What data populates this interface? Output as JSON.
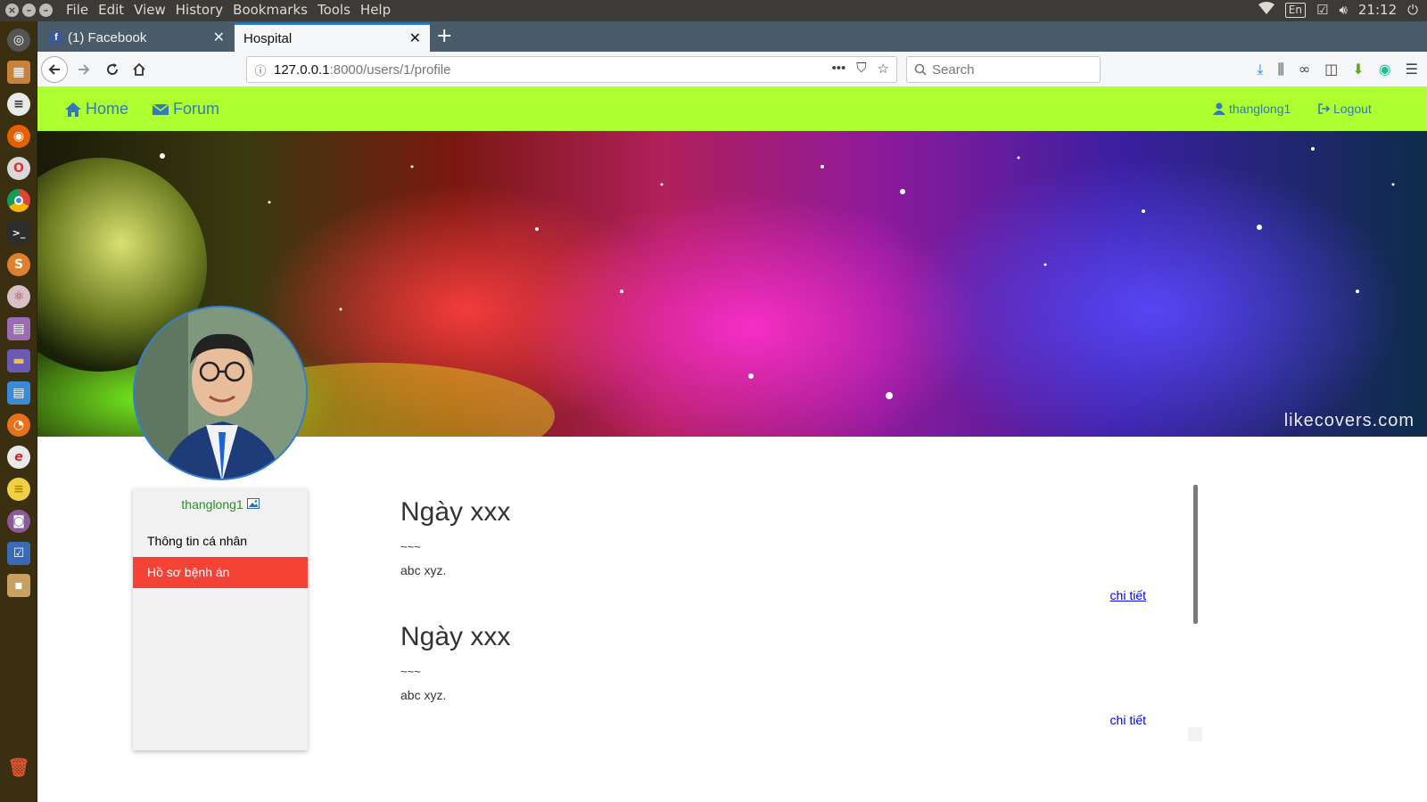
{
  "system": {
    "menus": [
      "File",
      "Edit",
      "View",
      "History",
      "Bookmarks",
      "Tools",
      "Help"
    ],
    "keyboard_layout": "En",
    "clock": "21:12"
  },
  "browser": {
    "tabs": [
      {
        "title": "(1) Facebook",
        "active": false
      },
      {
        "title": "Hospital",
        "active": true
      }
    ],
    "url_host": "127.0.0.1",
    "url_path": ":8000/users/1/profile",
    "search_placeholder": "Search"
  },
  "site": {
    "nav": {
      "home": "Home",
      "forum": "Forum",
      "username": "thanglong1",
      "logout": "Logout"
    },
    "cover_watermark": "likecovers.com",
    "sidebar": {
      "username": "thanglong1",
      "items": [
        {
          "label": "Thông tin cá nhân",
          "active": false
        },
        {
          "label": "Hồ sơ bệnh án",
          "active": true
        }
      ]
    },
    "entries": [
      {
        "title": "Ngày xxx",
        "tilde": "~~~",
        "desc": "abc xyz.",
        "link": "chi tiết"
      },
      {
        "title": "Ngày xxx",
        "tilde": "~~~",
        "desc": "abc xyz.",
        "link": "chi tiết"
      }
    ]
  },
  "colors": {
    "site_nav_bg": "#adff2f",
    "link_blue": "#337ab7",
    "active_item": "#f44336",
    "username_green": "#2e8b2e"
  }
}
